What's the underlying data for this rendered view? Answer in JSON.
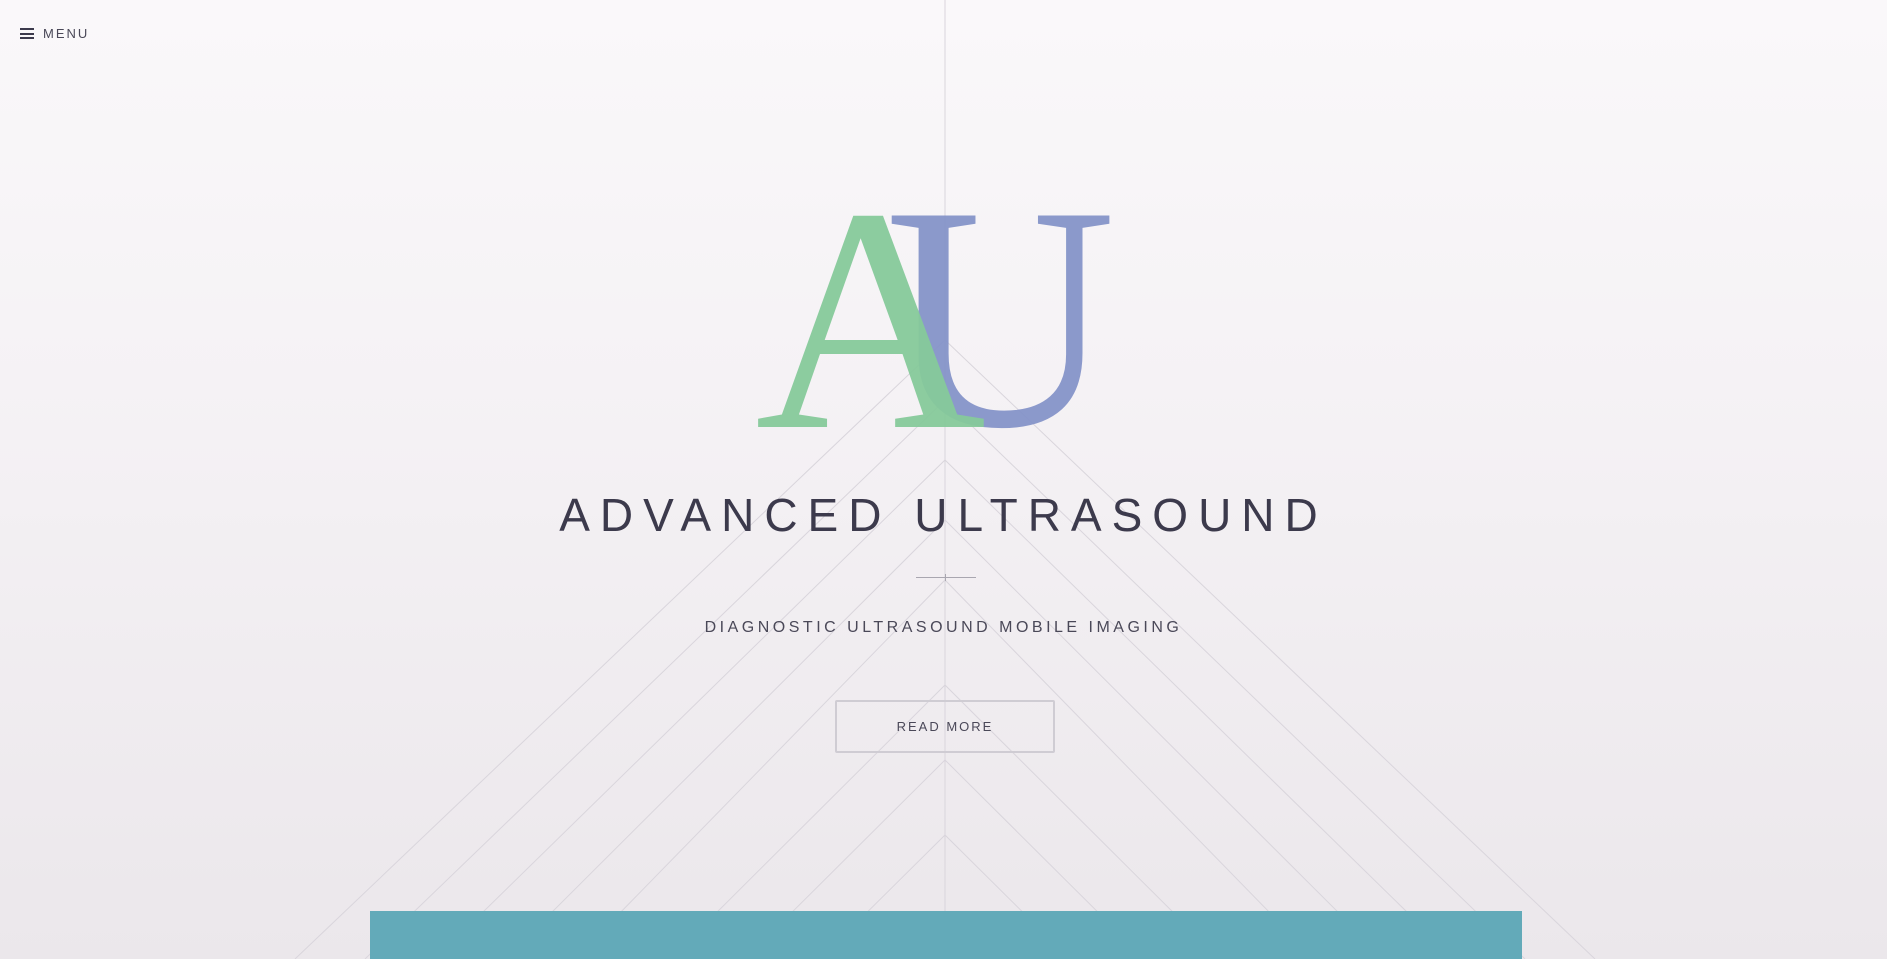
{
  "menu": {
    "label": "MENU",
    "icon": "hamburger-menu-icon"
  },
  "logo": {
    "letters": [
      "A",
      "U"
    ],
    "colors": {
      "a": "#86c99a",
      "u": "#8594c8",
      "wave_start": "#3aa9e0",
      "wave_mid": "#9b3fd8",
      "wave_end": "#e8559a"
    }
  },
  "hero": {
    "title": "ADVANCED ULTRASOUND",
    "subtitle": "DIAGNOSTIC ULTRASOUND MOBILE IMAGING",
    "cta_label": "READ MORE"
  },
  "colors": {
    "accent_panel": "#63aab9",
    "text": "#3c3a4c"
  }
}
